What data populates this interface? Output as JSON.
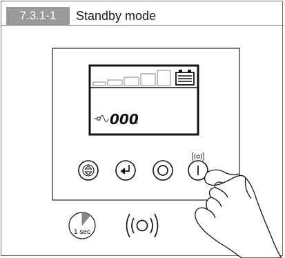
{
  "section": {
    "number": "7.3.1-1",
    "title": "Standby mode"
  },
  "display": {
    "value": "000",
    "unit": "Vac"
  },
  "timer": {
    "label": "1 sec"
  },
  "icons": {
    "scroll_button": "up-down-arrows-icon",
    "enter_button": "enter-arrow-icon",
    "off_button": "standby-circle-icon",
    "on_button": "power-line-icon",
    "press_indicator": "vibration-icon",
    "hold_feedback": "vibration-waves-icon",
    "battery": "battery-icon",
    "input": "ac-input-plug-icon"
  },
  "colors": {
    "tag_background": "#9a9a9a",
    "timer_fill": "#888888"
  }
}
